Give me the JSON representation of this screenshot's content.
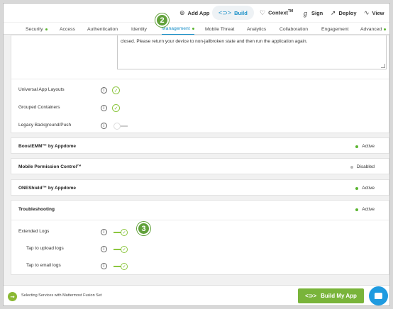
{
  "toolbar": {
    "add_app": {
      "icon": "plus-circle-icon",
      "label": "Add App"
    },
    "build": {
      "icon": "build-brackets-icon",
      "label": "Build"
    },
    "context": {
      "icon": "lightbulb-icon",
      "label": "Context",
      "mark": "TM"
    },
    "sign": {
      "icon": "signature-icon",
      "label": "Sign"
    },
    "deploy": {
      "icon": "rocket-icon",
      "label": "Deploy"
    },
    "view": {
      "icon": "chart-line-icon",
      "label": "View"
    }
  },
  "tabs": [
    {
      "label": "Security",
      "dot": true
    },
    {
      "label": "Access",
      "dot": false
    },
    {
      "label": "Authentication",
      "dot": false
    },
    {
      "label": "Identity",
      "dot": false
    },
    {
      "label": "Management",
      "dot": true,
      "active": true
    },
    {
      "label": "Mobile Threat",
      "dot": false
    },
    {
      "label": "Analytics",
      "dot": false
    },
    {
      "label": "Collaboration",
      "dot": false
    },
    {
      "label": "Engagement",
      "dot": false
    },
    {
      "label": "Advanced",
      "dot": true
    }
  ],
  "steps": {
    "two": "2",
    "three": "3"
  },
  "management": {
    "message": "closed. Please return your device to non-jailbroken state and then run the application again.",
    "options": [
      {
        "label": "Universal App Layouts",
        "info": "i",
        "control": "check",
        "on": true
      },
      {
        "label": "Grouped Containers",
        "info": "i",
        "control": "check",
        "on": true
      },
      {
        "label": "Legacy Background/Push",
        "info": "i",
        "control": "toggle",
        "on": false
      }
    ]
  },
  "services": [
    {
      "name": "BoostEMM™ by Appdome",
      "status": "Active",
      "color": "#5bb531"
    },
    {
      "name": "Mobile Permission Control™",
      "status": "Disabled",
      "color": "#b8b8b8"
    },
    {
      "name": "ONEShield™ by Appdome",
      "status": "Active",
      "color": "#5bb531"
    }
  ],
  "troubleshooting": {
    "title": "Troubleshooting",
    "status": "Active",
    "color": "#5bb531",
    "options": [
      {
        "label": "Extended Logs",
        "info": "i",
        "on": true
      },
      {
        "label": "Tap to upload logs",
        "info": "i",
        "on": true
      },
      {
        "label": "Tap to email logs",
        "info": "i",
        "on": true
      }
    ]
  },
  "bottom": {
    "status_text": "Selecting Services with Mattermost Fusion Set",
    "build_button": "Build My App",
    "build_icon": "build-brackets-icon",
    "chat_icon": "chat-bubble-icon"
  }
}
